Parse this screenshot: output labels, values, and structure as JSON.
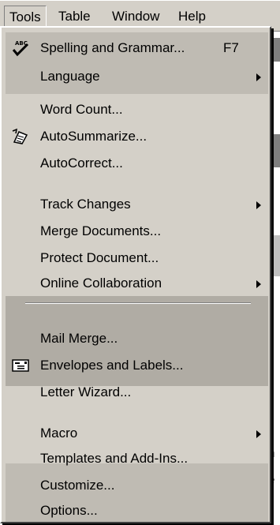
{
  "menubar": {
    "items": [
      {
        "label": "Tools",
        "open": true
      },
      {
        "label": "Table"
      },
      {
        "label": "Window"
      },
      {
        "label": "Help"
      }
    ]
  },
  "tools_menu": {
    "spelling": {
      "label": "Spelling and Grammar...",
      "shortcut": "F7",
      "icon": "spelling-check-icon"
    },
    "language": {
      "label": "Language",
      "submenu": true
    },
    "word_count": {
      "label": "Word Count..."
    },
    "autosummarize": {
      "label": "AutoSummarize...",
      "icon": "autosummarize-icon"
    },
    "autocorrect": {
      "label": "AutoCorrect..."
    },
    "track_changes": {
      "label": "Track Changes",
      "submenu": true
    },
    "merge_documents": {
      "label": "Merge Documents..."
    },
    "protect_document": {
      "label": "Protect Document..."
    },
    "online_collaboration": {
      "label": "Online Collaboration",
      "submenu": true
    },
    "mail_merge": {
      "label": "Mail Merge..."
    },
    "envelopes_labels": {
      "label": "Envelopes and Labels...",
      "icon": "envelope-icon"
    },
    "letter_wizard": {
      "label": "Letter Wizard..."
    },
    "macro": {
      "label": "Macro",
      "submenu": true
    },
    "templates": {
      "label": "Templates and Add-Ins..."
    },
    "customize": {
      "label": "Customize..."
    },
    "options": {
      "label": "Options..."
    }
  },
  "document_edge": {
    "glyphs": [
      "s",
      "n",
      "e"
    ]
  },
  "colors": {
    "menu_background": "#d4d0c8",
    "menu_band": "#bfbbb3"
  }
}
